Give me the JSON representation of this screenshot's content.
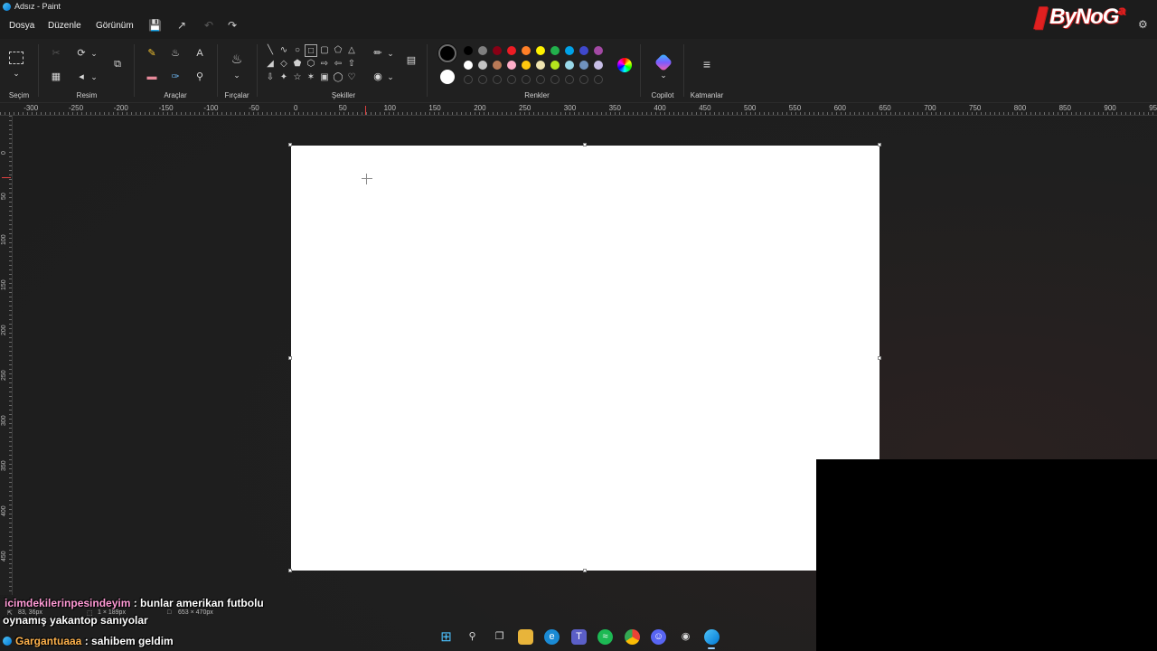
{
  "window": {
    "title": "Adsız - Paint"
  },
  "menu": {
    "file": "Dosya",
    "edit": "Düzenle",
    "view": "Görünüm"
  },
  "streamer": {
    "logo": "ByNoG",
    "logo_suffix": "a"
  },
  "ribbon": {
    "groups": {
      "selection": "Seçim",
      "image": "Resim",
      "tools": "Araçlar",
      "brushes": "Fırçalar",
      "shapes": "Şekiller",
      "colors": "Renkler",
      "copilot": "Copilot",
      "layers": "Katmanlar"
    },
    "palette_row1": [
      "#000000",
      "#7f7f7f",
      "#880015",
      "#ed1c24",
      "#ff7f27",
      "#fff200",
      "#22b14c",
      "#00a2e8",
      "#3f48cc",
      "#a349a4"
    ],
    "palette_row2": [
      "#ffffff",
      "#c3c3c3",
      "#b97a57",
      "#ffaec9",
      "#ffc90e",
      "#efe4b0",
      "#b5e61d",
      "#99d9ea",
      "#7092be",
      "#c8bfe7"
    ]
  },
  "ruler": {
    "h_labels": [
      "-300",
      "-250",
      "-200",
      "-150",
      "-100",
      "-50",
      "0",
      "50",
      "100",
      "150",
      "200",
      "250",
      "300",
      "350",
      "400",
      "450",
      "500",
      "550",
      "600",
      "650",
      "700",
      "750",
      "800",
      "850",
      "900",
      "950"
    ],
    "v_labels": [
      "0",
      "50",
      "100",
      "150",
      "200",
      "250",
      "300",
      "350",
      "400",
      "450"
    ]
  },
  "status": {
    "cursor_pos": "83, 36px",
    "selection_size": "1 × 189px",
    "canvas_size": "653 × 470px"
  },
  "chat": [
    {
      "user": "icimdekilerinpesindeyim",
      "message": " : bunlar amerikan futbolu",
      "continuation": "oynamış yakantop sanıyolar"
    },
    {
      "user": "Gargantuaaa",
      "message": " : sahibem geldim"
    }
  ]
}
